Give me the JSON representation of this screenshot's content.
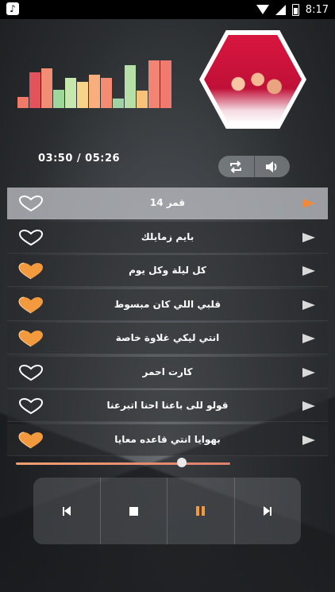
{
  "status_bar": {
    "time": "8:17"
  },
  "equalizer": {
    "levels": [
      0.22,
      0.7,
      0.78,
      0.36,
      0.6,
      0.52,
      0.66,
      0.6,
      0.18,
      0.84,
      0.34,
      0.93,
      0.93
    ],
    "colors": [
      "#f07a6a",
      "#e2535b",
      "#f08d74",
      "#9fd79a",
      "#c6e7ae",
      "#f8d48a",
      "#f7b07d",
      "#f38c72",
      "#9fd2a4",
      "#b6e0a8",
      "#f8c27a",
      "#f18472",
      "#f17a70"
    ]
  },
  "album": {
    "title": "قمر 14"
  },
  "player": {
    "time_display": "03:50 / 05:26",
    "progress": 0.72,
    "accent": "#f39a3e"
  },
  "controls": {
    "repeat_icon": "repeat-icon",
    "volume_icon": "volume-icon"
  },
  "tracks": [
    {
      "title": "قمر 14",
      "favorite": false,
      "active": true
    },
    {
      "title": "بايم زمايلك",
      "favorite": false,
      "active": false
    },
    {
      "title": "كل ليلة وكل يوم",
      "favorite": true,
      "active": false
    },
    {
      "title": "قلبي اللي كان مبسوط",
      "favorite": true,
      "active": false
    },
    {
      "title": "انتي ليكي غلاوة خاصة",
      "favorite": true,
      "active": false
    },
    {
      "title": "كارت احمر",
      "favorite": false,
      "active": false
    },
    {
      "title": "قولو للى باعنا احنا اتبرعنا",
      "favorite": false,
      "active": false
    },
    {
      "title": "بهوايا انتي قاعده معايا",
      "favorite": true,
      "active": false
    }
  ]
}
